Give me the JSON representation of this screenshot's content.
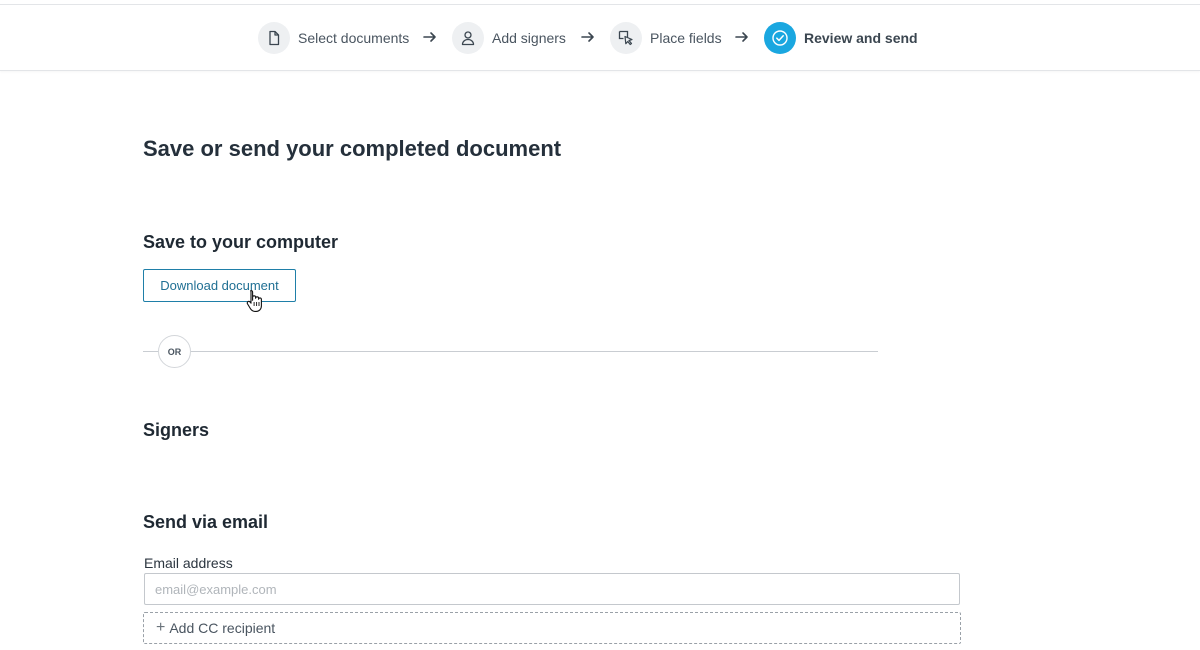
{
  "stepper": {
    "steps": [
      {
        "label": "Select documents",
        "icon": "document-icon",
        "active": false
      },
      {
        "label": "Add signers",
        "icon": "person-icon",
        "active": false
      },
      {
        "label": "Place fields",
        "icon": "place-field-icon",
        "active": false
      },
      {
        "label": "Review and send",
        "icon": "check-circle-icon",
        "active": true
      }
    ]
  },
  "colors": {
    "accent": "#1aa7e0",
    "button_border": "#1f7fa8",
    "step_bg": "#eef0f2"
  },
  "main": {
    "title": "Save or send your completed document",
    "save_section": {
      "heading": "Save to your computer",
      "download_label": "Download document"
    },
    "or_label": "OR",
    "signers_heading": "Signers",
    "email_section": {
      "heading": "Send via email",
      "email_label": "Email address",
      "email_placeholder": "email@example.com",
      "email_value": "",
      "add_cc_label": "Add CC recipient"
    }
  }
}
